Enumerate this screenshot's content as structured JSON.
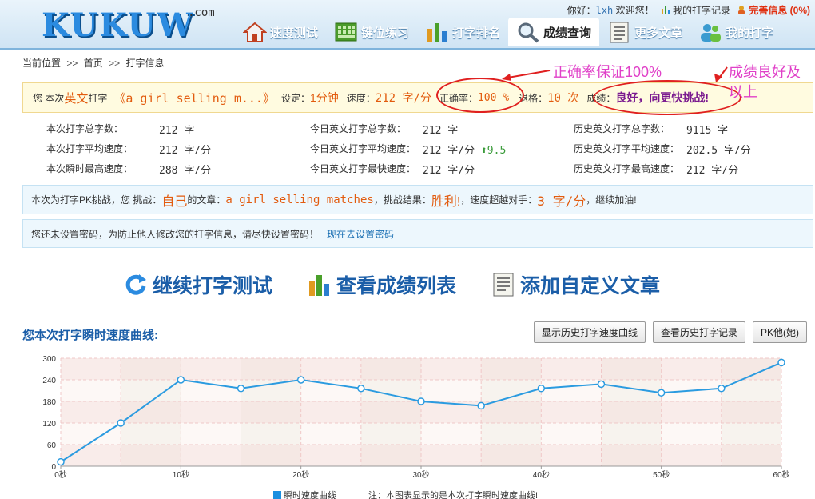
{
  "header": {
    "logo": "KUKUW",
    "logo_suffix": ".com",
    "greeting": "你好：",
    "username": "lxh",
    "welcome": "欢迎您！",
    "my_records_link": "我的打字记录",
    "complete_info_link": "完善信息 (0%)"
  },
  "nav": [
    {
      "label": "速度测试",
      "icon": "house-icon"
    },
    {
      "label": "键位练习",
      "icon": "keyboard-icon"
    },
    {
      "label": "打字排名",
      "icon": "bar-chart-icon"
    },
    {
      "label": "成绩查询",
      "icon": "magnifier-icon"
    },
    {
      "label": "更多文章",
      "icon": "document-icon"
    },
    {
      "label": "我的打字",
      "icon": "users-icon"
    }
  ],
  "breadcrumb": {
    "prefix": "当前位置",
    "sep": ">>",
    "home": "首页",
    "current": "打字信息"
  },
  "result": {
    "t1": "您 本次",
    "lang": "英文",
    "t2": "打字",
    "article": "《a girl selling m...》",
    "setting_label": "设定：",
    "setting_value": "1分钟",
    "speed_label": "速度：",
    "speed_value": "212 字/分",
    "accuracy_label": "正确率：",
    "accuracy_value": "100 %",
    "backspace_label": "退格：",
    "backspace_value": "10 次",
    "grade_label": "成绩：",
    "grade_value": "良好，向更快挑战!"
  },
  "annotations": {
    "accuracy_note": "正确率保证100%",
    "grade_note_line1": "成绩良好及",
    "grade_note_line2": "以上"
  },
  "stats": {
    "col1": [
      {
        "label": "本次打字总字数：",
        "value": "212 字"
      },
      {
        "label": "本次打字平均速度：",
        "value": "212 字/分"
      },
      {
        "label": "本次瞬时最高速度：",
        "value": "288 字/分"
      }
    ],
    "col2": [
      {
        "label": "今日英文打字总字数：",
        "value": "212 字"
      },
      {
        "label": "今日英文打字平均速度：",
        "value": "212 字/分",
        "delta": "9.5"
      },
      {
        "label": "今日英文打字最快速度：",
        "value": "212 字/分"
      }
    ],
    "col3": [
      {
        "label": "历史英文打字总字数：",
        "value": "9115 字"
      },
      {
        "label": "历史英文打字平均速度：",
        "value": "202.5 字/分"
      },
      {
        "label": "历史英文打字最高速度：",
        "value": "212 字/分"
      }
    ]
  },
  "pk": {
    "t1": "本次为打字PK挑战，您 挑战：",
    "opponent": "自己",
    "t2": "的文章：",
    "article": "a girl selling matches",
    "t3": "，挑战结果：",
    "outcome": "胜利!",
    "t4": "，速度超越对手：",
    "margin": "3 字/分",
    "t5": "，继续加油!"
  },
  "password": {
    "notice": "您还未设置密码，为防止他人修改您的打字信息，请尽快设置密码！",
    "link": "现在去设置密码"
  },
  "actions": [
    {
      "label": "继续打字测试",
      "icon": "refresh-icon"
    },
    {
      "label": "查看成绩列表",
      "icon": "bar-chart-icon"
    },
    {
      "label": "添加自定义文章",
      "icon": "document-icon"
    }
  ],
  "chart_section": {
    "title": "您本次打字瞬时速度曲线:",
    "btn_history_curve": "显示历史打字速度曲线",
    "btn_history_records": "查看历史打字记录",
    "btn_pk": "PK他(她)",
    "legend_series": "瞬时速度曲线",
    "legend_note": "注：本图表显示的是本次打字瞬时速度曲线!"
  },
  "chart_data": {
    "type": "line",
    "x": [
      0,
      5,
      10,
      15,
      20,
      25,
      30,
      35,
      40,
      45,
      50,
      55,
      60
    ],
    "x_tick_values": [
      0,
      10,
      20,
      30,
      40,
      50,
      60
    ],
    "x_tick_labels": [
      "0秒",
      "10秒",
      "20秒",
      "30秒",
      "40秒",
      "50秒",
      "60秒"
    ],
    "y_ticks": [
      0,
      60,
      120,
      180,
      240,
      300
    ],
    "ylim": [
      0,
      300
    ],
    "xlim": [
      0,
      60
    ],
    "series": [
      {
        "name": "瞬时速度曲线",
        "values": [
          12,
          120,
          240,
          216,
          240,
          216,
          180,
          168,
          216,
          228,
          204,
          216,
          288
        ]
      }
    ],
    "line_color": "#2b9be0"
  }
}
